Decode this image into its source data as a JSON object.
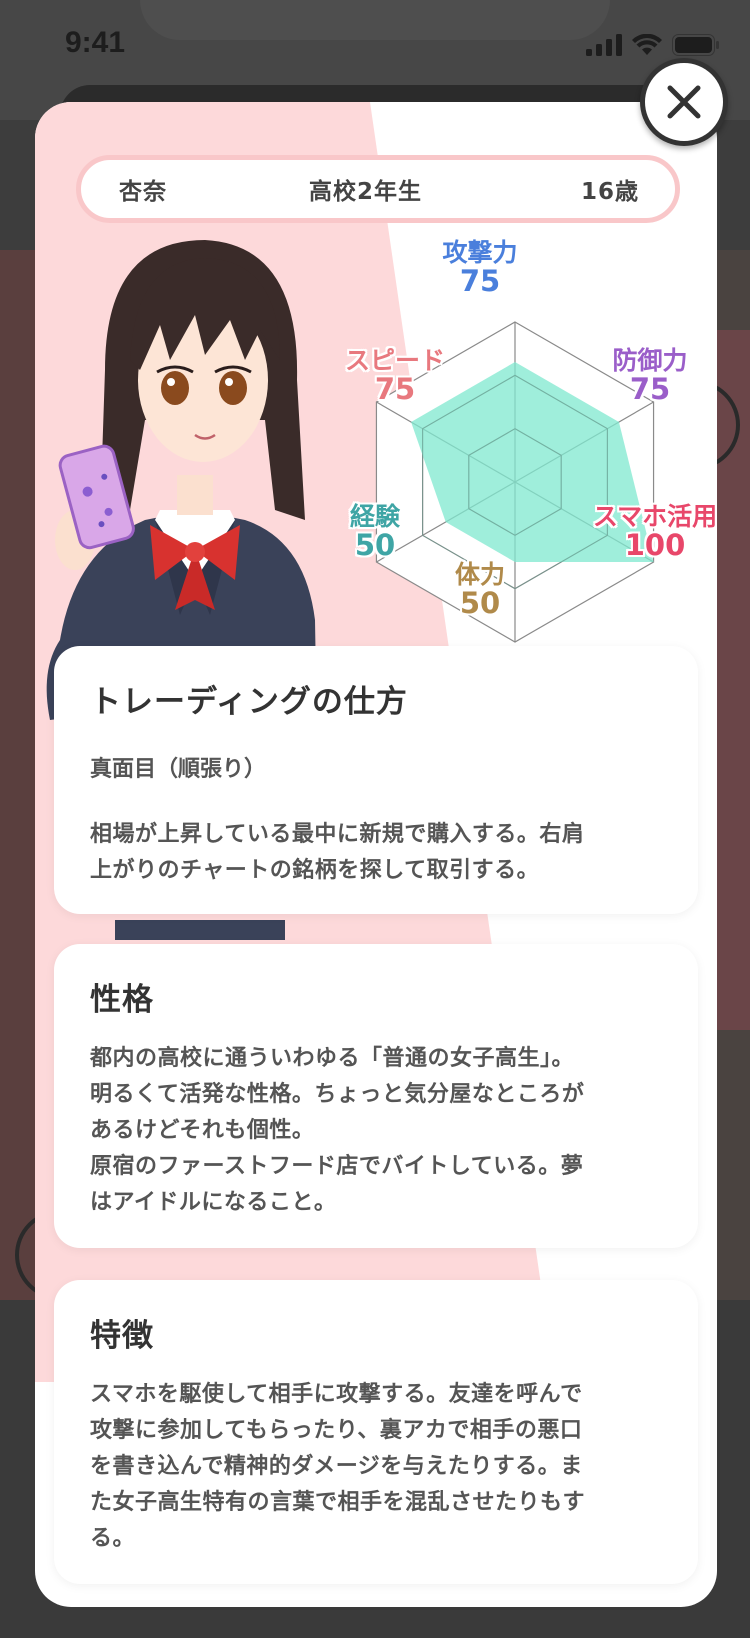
{
  "status_bar": {
    "time": "9:41"
  },
  "profile": {
    "name": "杏奈",
    "grade": "高校2年生",
    "age": "16歳"
  },
  "chart_data": {
    "type": "radar",
    "axes": [
      "攻撃力",
      "防御力",
      "スマホ活用",
      "体力",
      "経験",
      "スピード"
    ],
    "values": [
      75,
      75,
      100,
      50,
      50,
      75
    ],
    "max": 100,
    "label_colors": [
      "#4a7fdc",
      "#9a5ec9",
      "#e8476a",
      "#b08a4a",
      "#3fa5a5",
      "#e8787e"
    ],
    "fill_color": "#7fe8cf"
  },
  "cards": [
    {
      "title": "トレーディングの仕方",
      "subtitle": "真面目（順張り）",
      "lines": [
        "相場が上昇している最中に新規で購入する。右肩",
        "上がりのチャートの銘柄を探して取引する。"
      ]
    },
    {
      "title": "性格",
      "lines": [
        "都内の高校に通ういわゆる「普通の女子高生」。",
        "明るくて活発な性格。ちょっと気分屋なところが",
        "あるけどそれも個性。",
        "原宿のファーストフード店でバイトしている。夢",
        "はアイドルになること。"
      ]
    },
    {
      "title": "特徴",
      "lines": [
        "スマホを駆使して相手に攻撃する。友達を呼んで",
        "攻撃に参加してもらったり、裏アカで相手の悪口",
        "を書き込んで精神的ダメージを与えたりする。ま",
        "た女子高生特有の言葉で相手を混乱させたりもす",
        "る。"
      ]
    }
  ],
  "icons": {
    "close": "close-icon",
    "signal": "signal-icon",
    "wifi": "wifi-icon",
    "battery": "battery-icon"
  }
}
